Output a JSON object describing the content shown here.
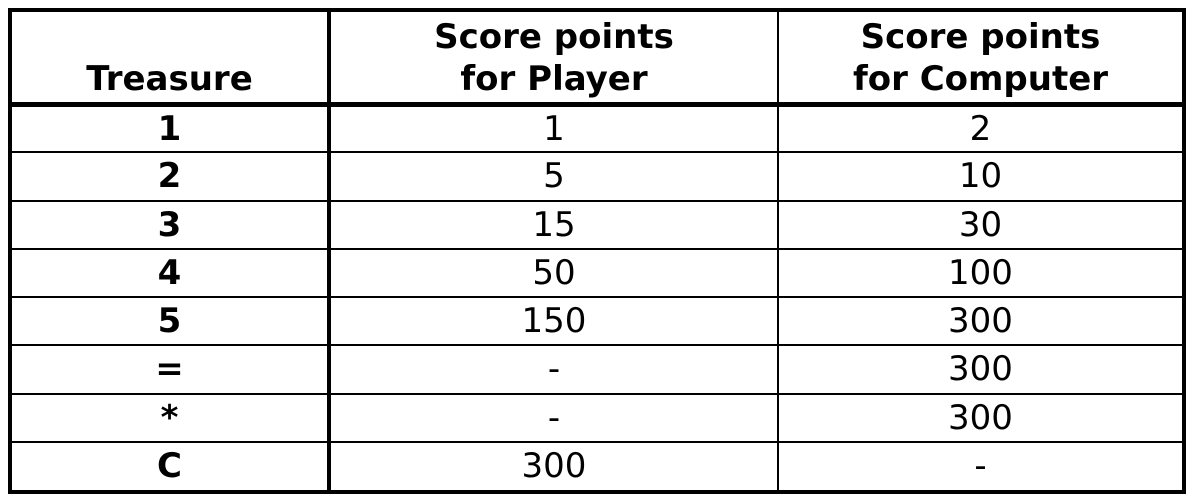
{
  "table": {
    "headers": [
      "Treasure",
      "Score points\nfor Player",
      "Score points\nfor Computer"
    ],
    "rows": [
      [
        "1",
        "1",
        "2"
      ],
      [
        "2",
        "5",
        "10"
      ],
      [
        "3",
        "15",
        "30"
      ],
      [
        "4",
        "50",
        "100"
      ],
      [
        "5",
        "150",
        "300"
      ],
      [
        "=",
        "-",
        "300"
      ],
      [
        "*",
        "-",
        "300"
      ],
      [
        "C",
        "300",
        "-"
      ]
    ]
  }
}
